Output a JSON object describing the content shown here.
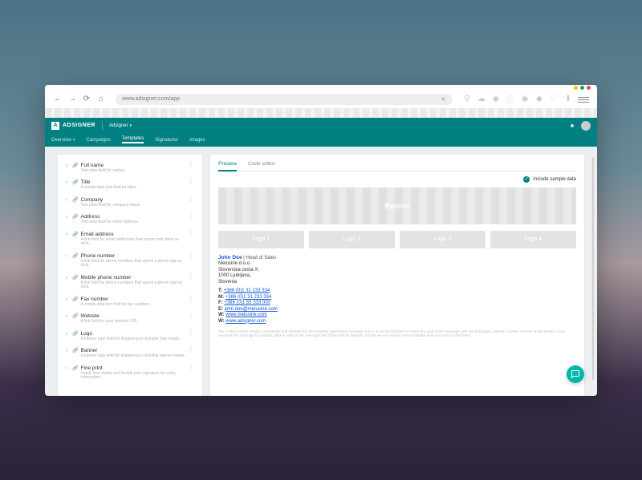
{
  "browser": {
    "url": "www.adsigner.com/app"
  },
  "app": {
    "brand": "ADSIGNER",
    "workspace": "Adsigner"
  },
  "nav": {
    "overview": "Overview",
    "campaigns": "Campaigns",
    "templates": "Templates",
    "signatures": "Signatures",
    "images": "Images"
  },
  "fields": [
    {
      "title": "Full name",
      "desc": "Text data-field for names."
    },
    {
      "title": "Title",
      "desc": "A simple data text field for titles."
    },
    {
      "title": "Company",
      "desc": "Text data-field for company name."
    },
    {
      "title": "Address",
      "desc": "Text data-field for street address."
    },
    {
      "title": "Email address",
      "desc": "A link field for email addresses that opens mail client on click."
    },
    {
      "title": "Phone number",
      "desc": "A link field for phone numbers that opens a phone app on click."
    },
    {
      "title": "Mobile phone number",
      "desc": "A link field for phone numbers that opens a phone app on click."
    },
    {
      "title": "Fax number",
      "desc": "A simple data text field for fax numbers."
    },
    {
      "title": "Website",
      "desc": "A link field for your website URL."
    },
    {
      "title": "Logo",
      "desc": "A banner type field for displaying a clickable logo image."
    },
    {
      "title": "Banner",
      "desc": "A banner type field for displaying a clickable banner image."
    },
    {
      "title": "Fine print",
      "desc": "Small, less visible text beside your signature for extra information."
    }
  ],
  "right": {
    "tab_preview": "Preview",
    "tab_code": "Code editor",
    "sample": "Include sample data",
    "banner": "Banner",
    "logos": [
      "Logo 1",
      "Logo 2",
      "Logo 3",
      "Logo 4"
    ],
    "sig": {
      "name": "John Doe",
      "role": "Head of Sales",
      "company": "Melusine d.o.o.",
      "street": "Slovenska cesta X,",
      "city": "1000 Ljubljana,",
      "country": "Slovenia",
      "t_label": "T:",
      "t": "+386 (0)1 31 233 334",
      "m_label": "M:",
      "m": "+386 (0)1 31 233 334",
      "f_label": "F:",
      "f": "+386 (0)1 55 333 000",
      "e_label": "E:",
      "e": "john.doe@melusine.com",
      "w1_label": "W:",
      "w1": "www.melusine.com",
      "w2_label": "W:",
      "w2": "www.adsigner.com"
    },
    "fine": "The content of this email is confidential and intended for the recipient specified in message only. It is strictly forbidden to share any part of this message with any third party, without a written consent of the sender. If you received this message by mistake, please reply to this message and follow with its deletion, so that we can ensure such a mistake does not occur in the future."
  }
}
